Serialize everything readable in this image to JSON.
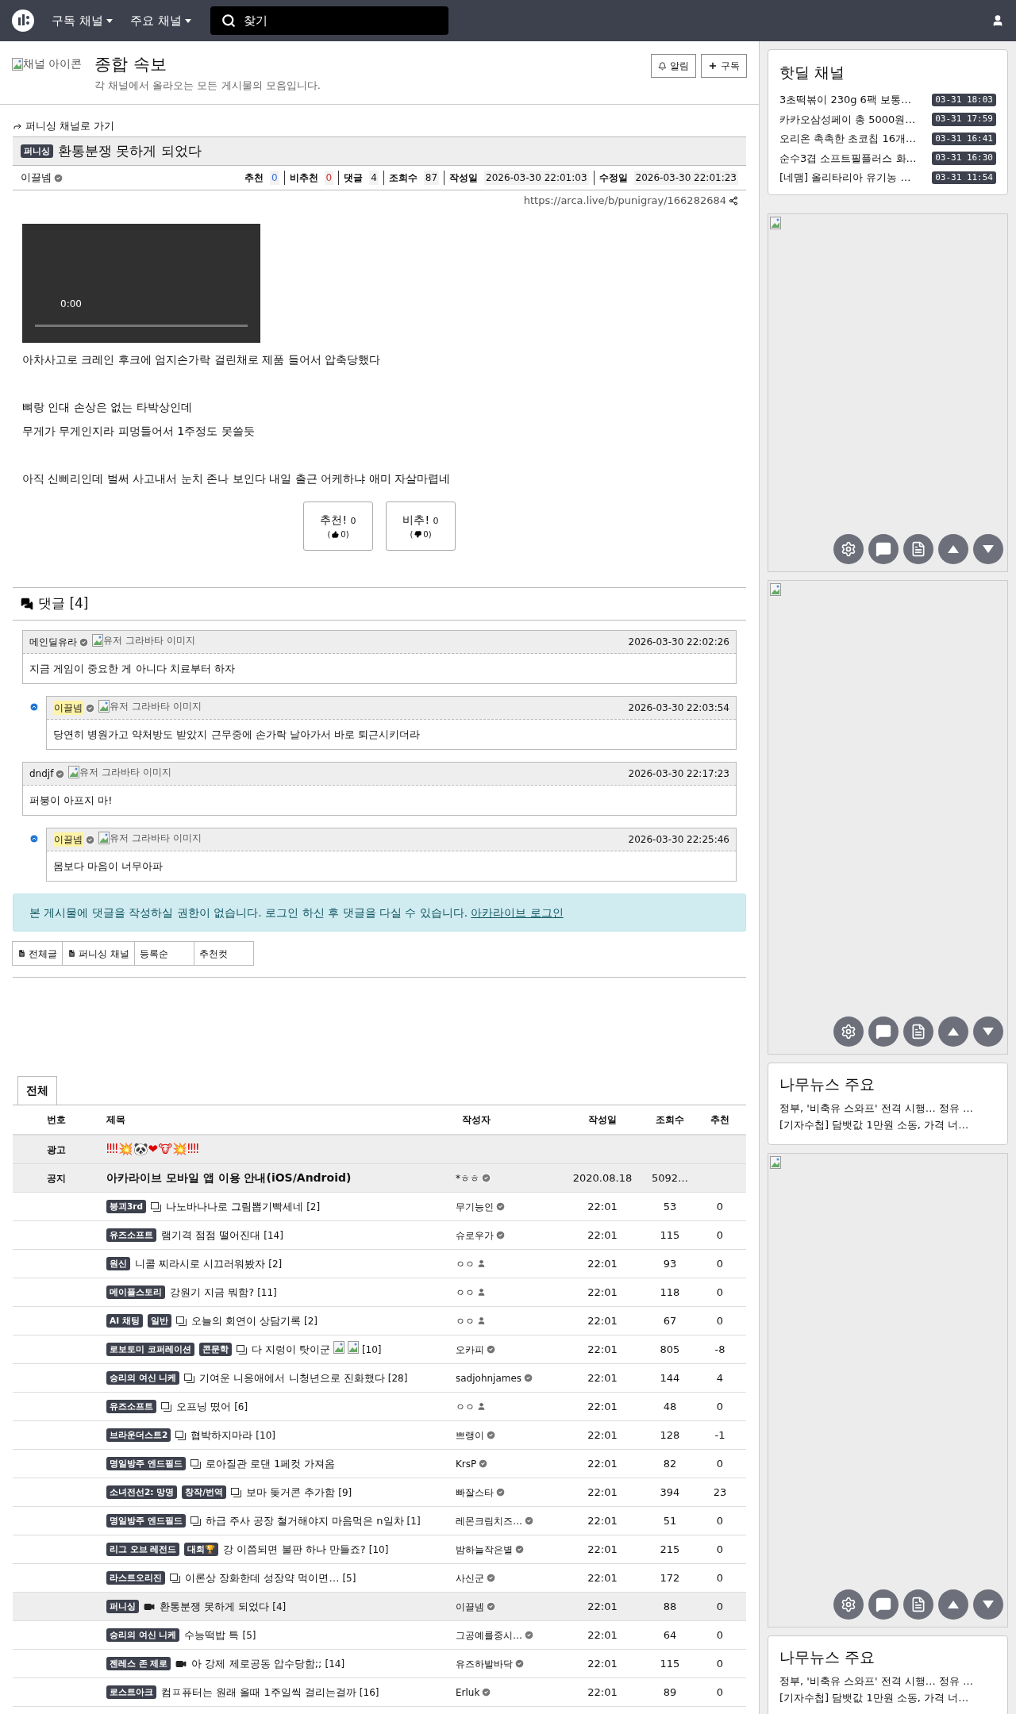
{
  "nav": {
    "menus": [
      {
        "label": "구독 채널"
      },
      {
        "label": "주요 채널"
      }
    ],
    "search": {
      "placeholder": "찾기"
    }
  },
  "channel": {
    "icon_alt": "채널 아이콘",
    "title": "종합 속보",
    "description": "각 채널에서 올라오는 모든 게시물의 모음입니다.",
    "buttons": [
      {
        "kind": "bell",
        "label": "알림"
      },
      {
        "kind": "plus",
        "label": "구독"
      }
    ]
  },
  "post": {
    "back_link": "퍼니싱 채널로 가기",
    "category": "퍼니싱",
    "title": "환통분쟁 못하게 되었다",
    "author": "이끌넴",
    "stats": [
      {
        "label": "추천",
        "value": "0",
        "kind": "up"
      },
      {
        "label": "비추천",
        "value": "0",
        "kind": "down"
      },
      {
        "label": "댓글",
        "value": "4",
        "kind": "plain"
      },
      {
        "label": "조회수",
        "value": "87",
        "kind": "plain"
      },
      {
        "label": "작성일",
        "value": "2026-03-30 22:01:03",
        "kind": "plain"
      },
      {
        "label": "수정일",
        "value": "2026-03-30 22:01:23",
        "kind": "plain"
      }
    ],
    "url": "https://arca.live/b/punigray/166282684",
    "video_time": "0:00",
    "paragraphs": [
      [
        "아차사고로 크레인 후크에 엄지손가락 걸린채로 제품 들어서 압축당했다"
      ],
      [
        "뼈랑 인대 손상은 없는 타박상인데",
        "무게가 무게인지라 피멍들어서 1주정도 못쓸듯"
      ],
      [
        "아직 신삐리인데 벌써 사고내서 눈치 존나 보인다 내일 출근 어케하냐 애미 자살마렵네"
      ]
    ],
    "votes": [
      {
        "kind": "up",
        "label": "추천!",
        "count": "0",
        "open": "(",
        "sub": "0)"
      },
      {
        "kind": "down",
        "label": "비추!",
        "count": "0",
        "open": "(",
        "sub": "0)"
      }
    ]
  },
  "comments": {
    "title": "댓글 [4]",
    "items": [
      {
        "author": "메인딜유라",
        "avatar_alt": "유저 그라바타 이미지",
        "is_op": false,
        "reply": false,
        "date": "2026-03-30 22:02:26",
        "text": "지금 게임이 중요한 게 아니다 치료부터 하자"
      },
      {
        "author": "이끌넴",
        "avatar_alt": "유저 그라바타 이미지",
        "is_op": true,
        "reply": true,
        "date": "2026-03-30 22:03:54",
        "text": "당연히 병원가고 약처방도 받았지 근무중에 손가락 날아가서 바로 퇴근시키더라"
      },
      {
        "author": "dndjf",
        "avatar_alt": "유저 그라바타 이미지",
        "is_op": false,
        "reply": false,
        "date": "2026-03-30 22:17:23",
        "text": "퍼붕이 아프지 마!"
      },
      {
        "author": "이끌넴",
        "avatar_alt": "유저 그라바타 이미지",
        "is_op": true,
        "reply": true,
        "date": "2026-03-30 22:25:46",
        "text": "몸보다 마음이 너무아파"
      }
    ],
    "notice": "본 게시물에 댓글을 작성하실 권한이 없습니다. 로그인 하신 후 댓글을 다실 수 있습니다.",
    "login_link": "아카라이브 로그인"
  },
  "list_tabs": [
    {
      "label": "전체글",
      "icon": true
    },
    {
      "label": "퍼니싱 채널",
      "icon": true
    },
    {
      "label": "등록순",
      "icon": false
    },
    {
      "label": "추천컷",
      "icon": false
    }
  ],
  "board": {
    "tab": "전체",
    "columns": [
      "번호",
      "제목",
      "작성자",
      "작성일",
      "조회수",
      "추천"
    ],
    "rows": [
      {
        "kind": "ad",
        "number": "광고",
        "title": "‼‼💥🐼❤🐮💥‼‼"
      },
      {
        "kind": "notice",
        "number": "공지",
        "title": "아카라이브 모바일 앱 이용 안내(iOS/Android)",
        "author": {
          "name": "*ㅎㅎ",
          "kind": "verified"
        },
        "date": "2020.08.18",
        "views": "5092…"
      },
      {
        "kind": "post",
        "badges": [
          "붕괴3rd"
        ],
        "media": {
          "kind": "image"
        },
        "title": "나노바나나로 그림뽑기빡세네",
        "comments": "[2]",
        "author": {
          "name": "무기능인",
          "kind": "verified"
        },
        "date": "22:01",
        "views": "53",
        "likes": "0",
        "selected": false
      },
      {
        "kind": "post",
        "badges": [
          "유즈소프트"
        ],
        "title": "램기격 점점 떨어진대",
        "comments": "[14]",
        "author": {
          "name": "슈로우가",
          "kind": "verified"
        },
        "date": "22:01",
        "views": "115",
        "likes": "0",
        "selected": false
      },
      {
        "kind": "post",
        "badges": [
          "원신"
        ],
        "title": "니콜 찌라시로 시끄러워봤자",
        "comments": "[2]",
        "author": {
          "name": "ㅇㅇ",
          "kind": "guest"
        },
        "date": "22:01",
        "views": "93",
        "likes": "0",
        "selected": false
      },
      {
        "kind": "post",
        "badges": [
          "메이플스토리"
        ],
        "title": "강원기 지금 뭐함?",
        "comments": "[11]",
        "author": {
          "name": "ㅇㅇ",
          "kind": "guest"
        },
        "date": "22:01",
        "views": "118",
        "likes": "0",
        "selected": false
      },
      {
        "kind": "post",
        "badges": [
          "AI 채팅",
          "일반"
        ],
        "media": {
          "kind": "image"
        },
        "title": "오늘의 회연이 상담기록",
        "comments": "[2]",
        "author": {
          "name": "ㅇㅇ",
          "kind": "guest"
        },
        "date": "22:01",
        "views": "67",
        "likes": "0",
        "selected": false
      },
      {
        "kind": "post",
        "badges": [
          "로보토미 코퍼레이션",
          "콘문학"
        ],
        "media": {
          "kind": "image"
        },
        "title": "다 지렁이 탓이군",
        "stickers": [
          {
            "kind": "broken"
          },
          {
            "kind": "broken"
          }
        ],
        "comments": "[10]",
        "author": {
          "name": "오카피",
          "kind": "verified"
        },
        "date": "22:01",
        "views": "805",
        "likes": "-8",
        "selected": false
      },
      {
        "kind": "post",
        "badges": [
          "승리의 여신 니케"
        ],
        "media": {
          "kind": "image"
        },
        "title": "기여운 니응애에서 니청년으로 진화했다",
        "comments": "[28]",
        "author": {
          "name": "sadjohnjames",
          "kind": "verified"
        },
        "date": "22:01",
        "views": "144",
        "likes": "4",
        "selected": false
      },
      {
        "kind": "post",
        "badges": [
          "유즈소프트"
        ],
        "media": {
          "kind": "image"
        },
        "title": "오프닝 떴어",
        "comments": "[6]",
        "author": {
          "name": "ㅇㅇ",
          "kind": "guest"
        },
        "date": "22:01",
        "views": "48",
        "likes": "0",
        "selected": false
      },
      {
        "kind": "post",
        "badges": [
          "브라운더스트2"
        ],
        "media": {
          "kind": "image"
        },
        "title": "협박하지마라",
        "comments": "[10]",
        "author": {
          "name": "쁘랭이",
          "kind": "verified"
        },
        "date": "22:01",
        "views": "128",
        "likes": "-1",
        "selected": false
      },
      {
        "kind": "post",
        "badges": [
          "명일방주 엔드필드"
        ],
        "media": {
          "kind": "image"
        },
        "title": "로아질관 로댄 1페컷 가져옴",
        "author": {
          "name": "KrsP",
          "kind": "verified"
        },
        "date": "22:01",
        "views": "82",
        "likes": "0",
        "selected": false
      },
      {
        "kind": "post",
        "badges": [
          "소녀전선2: 망명",
          "창작/번역"
        ],
        "media": {
          "kind": "image"
        },
        "title": "보마 돚거콘 추가함",
        "comments": "[9]",
        "author": {
          "name": "빠잘스타",
          "kind": "verified"
        },
        "date": "22:01",
        "views": "394",
        "likes": "23",
        "selected": false
      },
      {
        "kind": "post",
        "badges": [
          "명일방주 엔드필드"
        ],
        "media": {
          "kind": "image"
        },
        "title": "하급 주사 공장 철거해야지 마음먹은 n일차",
        "comments": "[1]",
        "author": {
          "name": "레몬크림치즈…",
          "kind": "verified"
        },
        "date": "22:01",
        "views": "51",
        "likes": "0",
        "selected": false
      },
      {
        "kind": "post",
        "badges": [
          "리그 오브 레전드",
          "대회🏆"
        ],
        "title": "강 이쯤되면 불판 하나 만들죠?",
        "comments": "[10]",
        "author": {
          "name": "밤하늘작은별",
          "kind": "verified"
        },
        "date": "22:01",
        "views": "215",
        "likes": "0",
        "selected": false
      },
      {
        "kind": "post",
        "badges": [
          "라스트오리진"
        ],
        "media": {
          "kind": "image"
        },
        "title": "이론상 장화한데 성장약 먹이면…",
        "comments": "[5]",
        "author": {
          "name": "사신군",
          "kind": "verified"
        },
        "date": "22:01",
        "views": "172",
        "likes": "0",
        "selected": false
      },
      {
        "kind": "post",
        "badges": [
          "퍼니싱"
        ],
        "media": {
          "kind": "video"
        },
        "title": "환통분쟁 못하게 되었다",
        "comments": "[4]",
        "author": {
          "name": "이끌넴",
          "kind": "verified"
        },
        "date": "22:01",
        "views": "88",
        "likes": "0",
        "selected": true
      },
      {
        "kind": "post",
        "badges": [
          "승리의 여신 니케"
        ],
        "title": "수능떡밥 특",
        "comments": "[5]",
        "author": {
          "name": "그공예를중시…",
          "kind": "verified"
        },
        "date": "22:01",
        "views": "64",
        "likes": "0",
        "selected": false
      },
      {
        "kind": "post",
        "badges": [
          "젠레스 존 제로"
        ],
        "media": {
          "kind": "video"
        },
        "title": "아 강제 제로공동 압수당함;;",
        "comments": "[14]",
        "author": {
          "name": "유즈하발바닥",
          "kind": "verified"
        },
        "date": "22:01",
        "views": "115",
        "likes": "0",
        "selected": false
      },
      {
        "kind": "post",
        "badges": [
          "로스트아크"
        ],
        "title": "컴ㅍ퓨터는 원래 올때 1주일씩 걸리는걸까",
        "comments": "[16]",
        "author": {
          "name": "Erluk",
          "kind": "verified"
        },
        "date": "22:01",
        "views": "89",
        "likes": "0",
        "selected": false
      }
    ]
  },
  "sidebar": [
    {
      "kind": "hotdeal",
      "title": "핫딜 채널",
      "items": [
        {
          "title": "3초떡볶이 230g 6팩 보통…",
          "time": "03-31 18:03"
        },
        {
          "title": "카카오삼성페이 총 5000원…",
          "time": "03-31 17:59"
        },
        {
          "title": "오리온 촉촉한 초코칩 16개…",
          "time": "03-31 16:41"
        },
        {
          "title": "순수3겹 소프트필플러스 화…",
          "time": "03-31 16:30"
        },
        {
          "title": "[네맴] 올리타리아 유기농 …",
          "time": "03-31 11:54"
        }
      ]
    },
    {
      "kind": "ad",
      "floating": true
    },
    {
      "kind": "ad",
      "floating": true
    },
    {
      "kind": "news",
      "title": "나무뉴스 주요",
      "items": [
        "정부, '비축유 스와프' 전격 시행… 정유 …",
        "[기자수첩] 담뱃값 1만원 소동, 가격 너…"
      ]
    },
    {
      "kind": "ad",
      "floating": true
    },
    {
      "kind": "news",
      "title": "나무뉴스 주요",
      "items": [
        "정부, '비축유 스와프' 전격 시행… 정유 …",
        "[기자수첩] 담뱃값 1만원 소동, 가격 너…"
      ]
    }
  ]
}
